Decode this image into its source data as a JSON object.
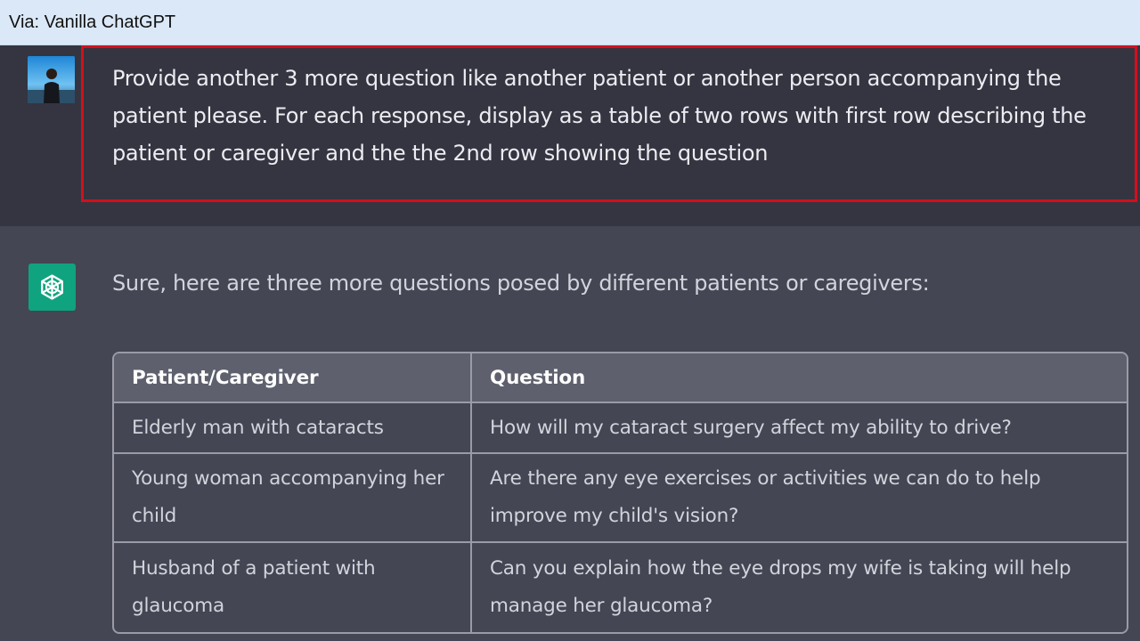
{
  "banner": {
    "label": "Via: Vanilla ChatGPT"
  },
  "user_message": {
    "text": "Provide another 3 more question  like another patient or another person accompanying the patient please. For each response, display as a table of two rows with first row describing the patient or caregiver and the the 2nd row showing the question"
  },
  "assistant_message": {
    "intro": "Sure, here are three more questions posed by different patients or caregivers:",
    "table": {
      "headers": [
        "Patient/Caregiver",
        "Question"
      ],
      "rows": [
        [
          "Elderly man with cataracts",
          "How will my cataract surgery affect my ability to drive?"
        ],
        [
          "Young woman accompanying her child",
          "Are there any eye exercises or activities we can do to help improve my child's vision?"
        ],
        [
          "Husband of a patient with glaucoma",
          "Can you explain how the eye drops my wife is taking will help manage her glaucoma?"
        ]
      ]
    }
  },
  "icons": {
    "user_avatar": "user-photo-avatar",
    "assistant_avatar": "openai-logo-icon"
  },
  "colors": {
    "highlight_border": "#d40f1b",
    "assistant_avatar_bg": "#10a37f",
    "banner_bg": "#dae8f8"
  }
}
